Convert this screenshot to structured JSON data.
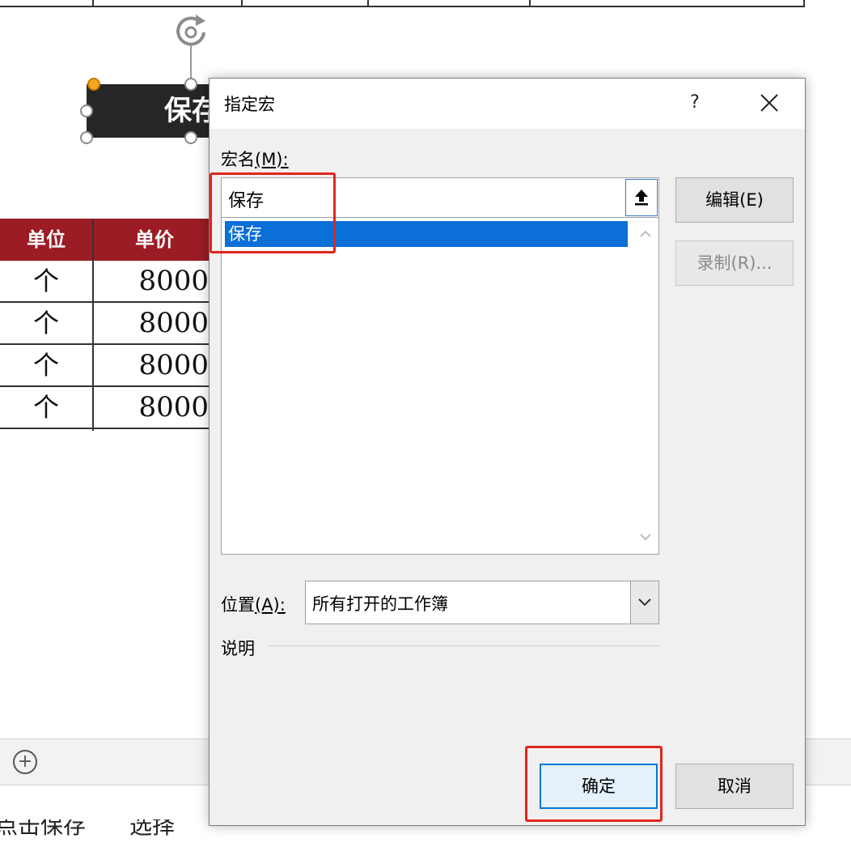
{
  "sheet": {
    "shape_button_text": "保存",
    "table": {
      "headers": [
        "单位",
        "单价"
      ],
      "rows": [
        {
          "unit": "个",
          "price": "8000"
        },
        {
          "unit": "个",
          "price": "8000"
        },
        {
          "unit": "个",
          "price": "8000"
        },
        {
          "unit": "个",
          "price": "8000"
        }
      ]
    },
    "bottom_text_left": "点击保存",
    "bottom_text_mid": "选择"
  },
  "dialog": {
    "title": "指定宏",
    "help_label": "?",
    "macro_name_label": "宏名",
    "macro_name_key": "(M):",
    "macro_name_value": "保存",
    "macro_list": [
      "保存"
    ],
    "edit_button": "编辑(E)",
    "record_button": "录制(R)...",
    "location_label": "位置",
    "location_key": "(A):",
    "location_value": "所有打开的工作簿",
    "description_label": "说明",
    "ok_button": "确定",
    "cancel_button": "取消"
  },
  "colors": {
    "accent_highlight": "#e0261c",
    "selection": "#0a6fd6",
    "table_header": "#9b1c24"
  }
}
